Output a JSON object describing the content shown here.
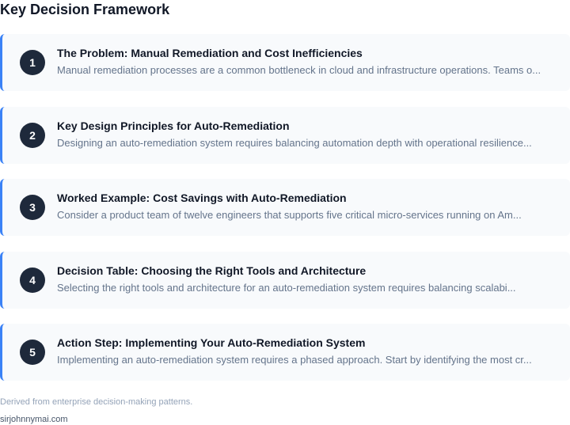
{
  "header": {
    "title": "Key Decision Framework"
  },
  "steps": [
    {
      "number": "1",
      "title": "The Problem: Manual Remediation and Cost Inefficiencies",
      "description": "Manual remediation processes are a common bottleneck in cloud and infrastructure operations. Teams o..."
    },
    {
      "number": "2",
      "title": "Key Design Principles for Auto-Remediation",
      "description": "Designing an auto-remediation system requires balancing automation depth with operational resilience..."
    },
    {
      "number": "3",
      "title": "Worked Example: Cost Savings with Auto-Remediation",
      "description": "Consider a product team of twelve engineers that supports five critical micro-services running on Am..."
    },
    {
      "number": "4",
      "title": "Decision Table: Choosing the Right Tools and Architecture",
      "description": "Selecting the right tools and architecture for an auto-remediation system requires balancing scalabi..."
    },
    {
      "number": "5",
      "title": "Action Step: Implementing Your Auto-Remediation System",
      "description": "Implementing an auto-remediation system requires a phased approach. Start by identifying the most cr..."
    }
  ],
  "footer": {
    "note": "Derived from enterprise decision-making patterns.",
    "source": "sirjohnnymai.com"
  },
  "colors": {
    "accent": "#3b82f6",
    "badge": "#1e293b",
    "card_background": "#f8fafc"
  }
}
